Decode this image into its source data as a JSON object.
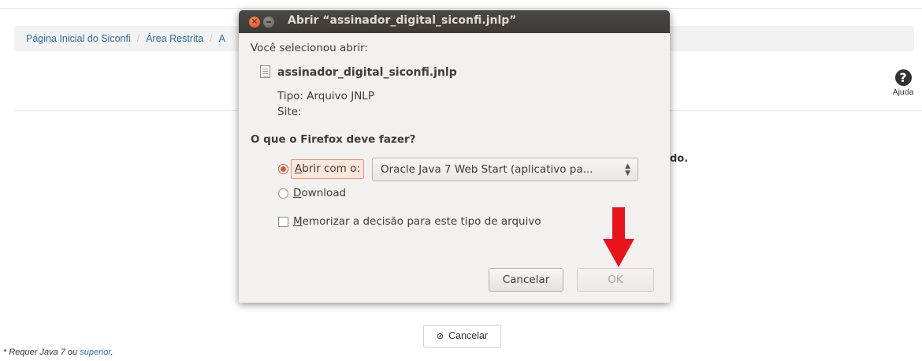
{
  "page": {
    "breadcrumb": [
      "Página Inicial do Siconfi",
      "Área Restrita",
      "A"
    ],
    "help_label": "Ajuda",
    "help_glyph": "?",
    "bg_text_fragment": "do.",
    "cancel_button": "Cancelar",
    "requires_note_prefix": "* Requer Java 7 ou ",
    "requires_note_link": "superior",
    "requires_note_suffix": "."
  },
  "dialog": {
    "title": "Abrir “assinador_digital_siconfi.jnlp”",
    "selected_text": "Você selecionou abrir:",
    "filename": "assinador_digital_siconfi.jnlp",
    "type_label": "Tipo: Arquivo JNLP",
    "site_label": "Site:",
    "question": "O que o Firefox deve fazer?",
    "open_with": {
      "mnemonic": "A",
      "rest": "brir com o:"
    },
    "app_selected": "Oracle Java 7 Web Start (aplicativo pa...",
    "download": {
      "mnemonic": "D",
      "rest": "ownload"
    },
    "remember": {
      "mnemonic": "M",
      "rest": "emorizar a decisão para este tipo de arquivo"
    },
    "cancel_button": "Cancelar",
    "ok_button": "OK"
  },
  "colors": {
    "link": "#2e6da4",
    "titlebar": "#3b3a36",
    "radio_accent": "#e0562c",
    "annotation_arrow": "#e8141c"
  }
}
